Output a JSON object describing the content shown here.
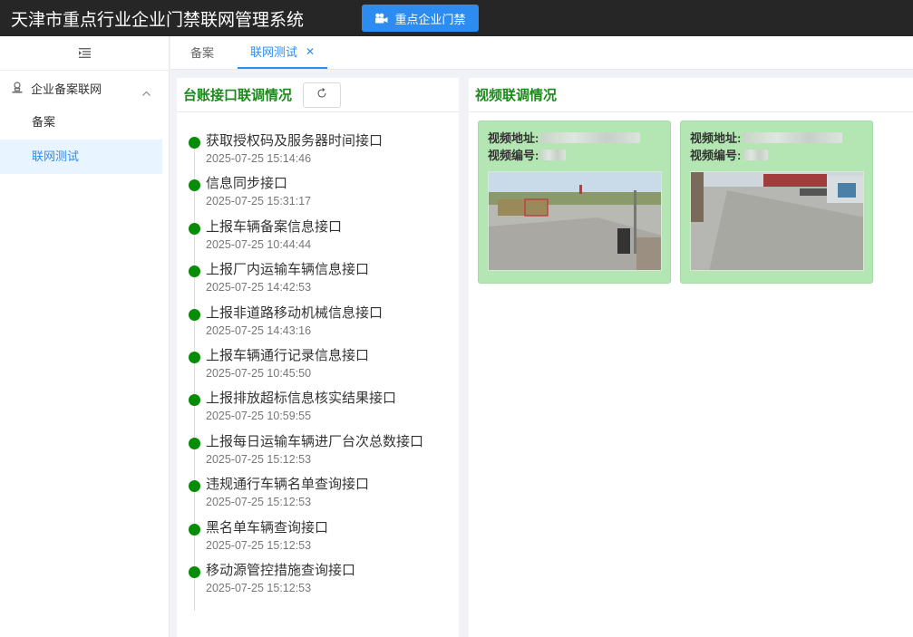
{
  "header": {
    "app_title": "天津市重点行业企业门禁联网管理系统",
    "nav_button_label": "重点企业门禁"
  },
  "sidebar": {
    "collapse_icon": "menu-fold-icon",
    "group": {
      "label": "企业备案联网",
      "icon": "user-stamp-icon",
      "expanded": true
    },
    "items": [
      {
        "label": "备案",
        "active": false
      },
      {
        "label": "联网测试",
        "active": true
      }
    ]
  },
  "tabs": [
    {
      "label": "备案",
      "active": false,
      "closable": false
    },
    {
      "label": "联网测试",
      "active": true,
      "closable": true
    }
  ],
  "ledger_panel": {
    "title": "台账接口联调情况",
    "refresh_icon": "refresh-icon",
    "status_color": "#078c07",
    "items": [
      {
        "name": "获取授权码及服务器时间接口",
        "time": "2025-07-25 15:14:46"
      },
      {
        "name": "信息同步接口",
        "time": "2025-07-25 15:31:17"
      },
      {
        "name": "上报车辆备案信息接口",
        "time": "2025-07-25 10:44:44"
      },
      {
        "name": "上报厂内运输车辆信息接口",
        "time": "2025-07-25 14:42:53"
      },
      {
        "name": "上报非道路移动机械信息接口",
        "time": "2025-07-25 14:43:16"
      },
      {
        "name": "上报车辆通行记录信息接口",
        "time": "2025-07-25 10:45:50"
      },
      {
        "name": "上报排放超标信息核实结果接口",
        "time": "2025-07-25 10:59:55"
      },
      {
        "name": "上报每日运输车辆进厂台次总数接口",
        "time": "2025-07-25 15:12:53"
      },
      {
        "name": "违规通行车辆名单查询接口",
        "time": "2025-07-25 15:12:53"
      },
      {
        "name": "黑名单车辆查询接口",
        "time": "2025-07-25 15:12:53"
      },
      {
        "name": "移动源管控措施查询接口",
        "time": "2025-07-25 15:12:53"
      }
    ]
  },
  "video_panel": {
    "title": "视频联调情况",
    "cards": [
      {
        "address_label": "视频地址:",
        "code_label": "视频编号:"
      },
      {
        "address_label": "视频地址:",
        "code_label": "视频编号:"
      }
    ]
  },
  "colors": {
    "accent": "#2d8cf0",
    "title_green": "#1a8a1a",
    "card_green": "#b3e6b3",
    "topbar": "#262626"
  }
}
